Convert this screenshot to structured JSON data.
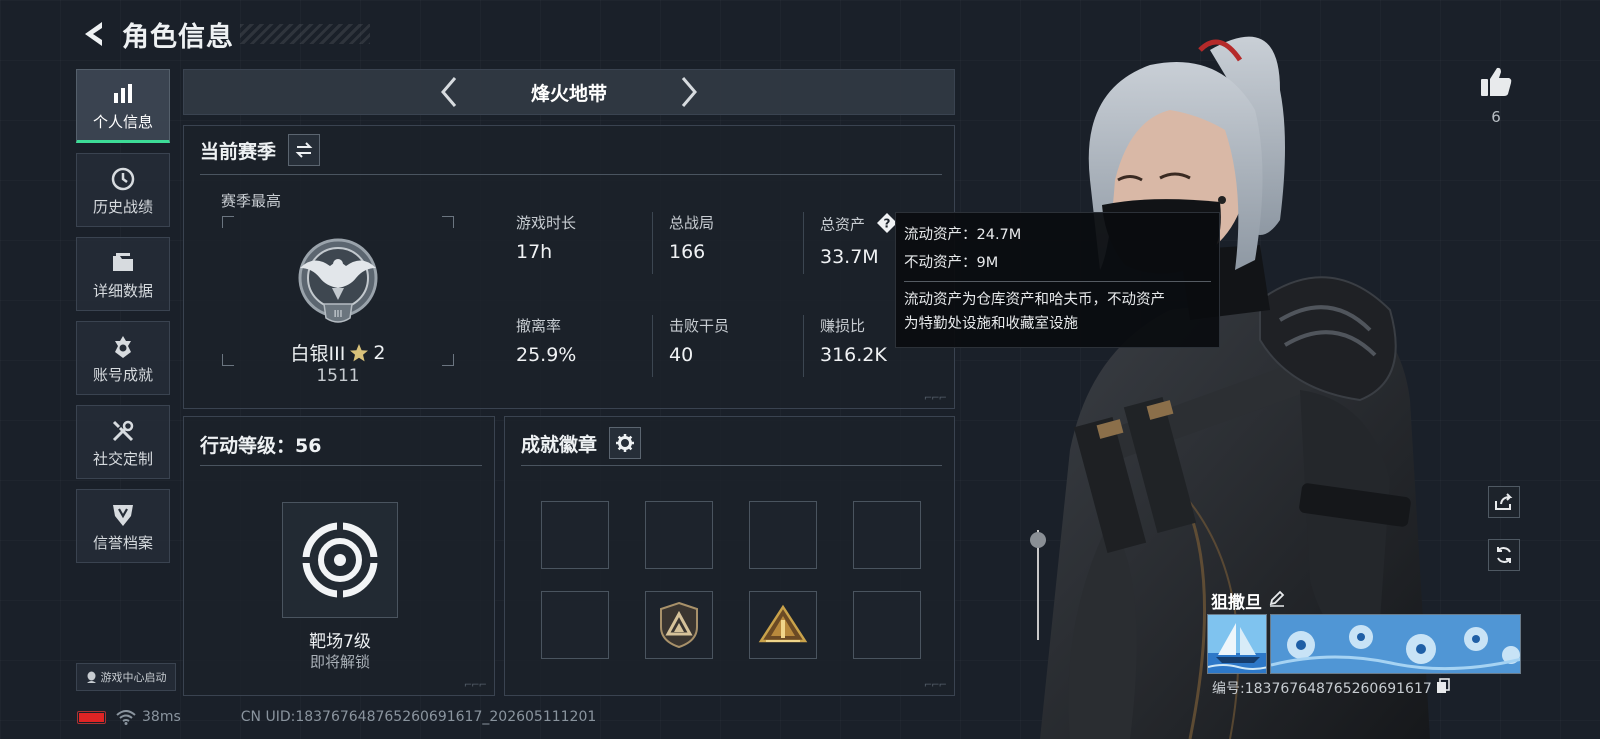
{
  "header": {
    "title": "角色信息"
  },
  "sidebar": {
    "items": [
      {
        "label": "个人信息",
        "icon": "bar-chart-icon",
        "active": true
      },
      {
        "label": "历史战绩",
        "icon": "clock-icon"
      },
      {
        "label": "详细数据",
        "icon": "folder-icon"
      },
      {
        "label": "账号成就",
        "icon": "medal-icon"
      },
      {
        "label": "社交定制",
        "icon": "tools-icon"
      },
      {
        "label": "信誉档案",
        "icon": "shield-icon"
      }
    ],
    "launch_label": "游戏中心启动"
  },
  "mode": {
    "name": "烽火地带"
  },
  "season": {
    "title": "当前赛季",
    "best_label": "赛季最高",
    "rank_name": "白银III",
    "rank_stars": "2",
    "rank_score": "1511",
    "stats": [
      {
        "label": "游戏时长",
        "value": "17h"
      },
      {
        "label": "总战局",
        "value": "166"
      },
      {
        "label": "总资产",
        "value": "33.7M"
      },
      {
        "label": "撤离率",
        "value": "25.9%"
      },
      {
        "label": "击败干员",
        "value": "40"
      },
      {
        "label": "赚损比",
        "value": "316.2K"
      }
    ]
  },
  "tooltip": {
    "liquid": "流动资产：24.7M",
    "fixed": "不动资产：9M",
    "desc_line1": "流动资产为仓库资产和哈夫币，不动资产",
    "desc_line2": "为特勤处设施和收藏室设施"
  },
  "level": {
    "title": "行动等级：56",
    "item_name": "靶场7级",
    "item_status": "即将解锁"
  },
  "achievements": {
    "title": "成就徽章"
  },
  "social": {
    "likes": "6"
  },
  "player": {
    "name": "狙撒旦",
    "id": "编号:183767648765260691617"
  },
  "status": {
    "ping": "38ms",
    "uid": "CN UID:183767648765260691617_202605111201"
  },
  "colors": {
    "accent": "#3ddc97",
    "battery": "#e02424",
    "badge_gold": "#c9a24a"
  }
}
